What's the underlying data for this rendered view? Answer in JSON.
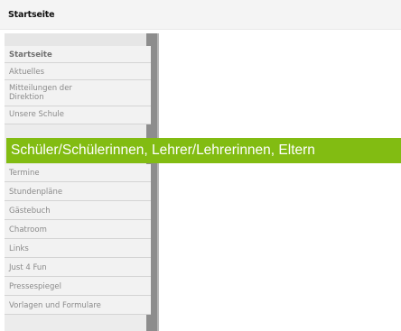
{
  "header": {
    "title": "Startseite"
  },
  "menu": {
    "items": [
      {
        "label": "Startseite"
      },
      {
        "label": "Aktuelles"
      },
      {
        "label": "Mitteilungen der Direktion"
      },
      {
        "label": "Unsere Schule"
      },
      {
        "label": "Termine"
      },
      {
        "label": "Stundenpläne"
      },
      {
        "label": "Gästebuch"
      },
      {
        "label": "Chatroom"
      },
      {
        "label": "Links"
      },
      {
        "label": "Just 4 Fun"
      },
      {
        "label": "Pressespiegel"
      },
      {
        "label": "Vorlagen und Formulare"
      }
    ]
  },
  "tooltip": {
    "text": "Schüler/Schülerinnen, Lehrer/Lehrerinnen, Eltern"
  },
  "colors": {
    "tooltip_bg": "#82bc12",
    "sidebar_rail": "#8d8d8d"
  }
}
